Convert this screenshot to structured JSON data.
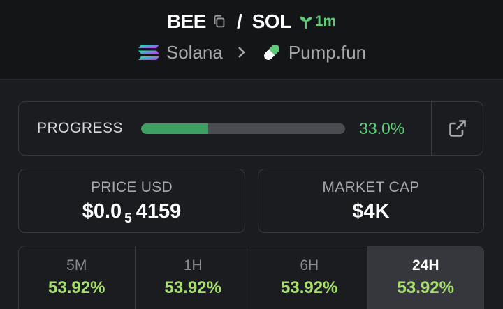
{
  "header": {
    "base_symbol": "BEE",
    "separator": "/",
    "quote_symbol": "SOL",
    "age": "1m",
    "chain": "Solana",
    "dex": "Pump.fun",
    "icons": {
      "copy": "copy-icon",
      "age": "sprout-icon",
      "chain": "solana-logo-icon",
      "breadcrumb": "chevron-right-icon",
      "dex": "pill-icon"
    }
  },
  "progress": {
    "label": "PROGRESS",
    "value_text": "33.0%",
    "fraction": 0.33,
    "accent": "#5fcb79",
    "icon": "external-link-icon"
  },
  "stats": {
    "price_label": "PRICE USD",
    "price_prefix": "$0.0",
    "price_zero_count": "5",
    "price_digits": "4159",
    "mcap_label": "MARKET CAP",
    "mcap_value": "$4K"
  },
  "timeframes": [
    {
      "label": "5M",
      "change": "53.92%"
    },
    {
      "label": "1H",
      "change": "53.92%"
    },
    {
      "label": "6H",
      "change": "53.92%"
    },
    {
      "label": "24H",
      "change": "53.92%",
      "active": true
    }
  ],
  "colors": {
    "positive": "#a6df6b",
    "background": "#1b1c20"
  }
}
